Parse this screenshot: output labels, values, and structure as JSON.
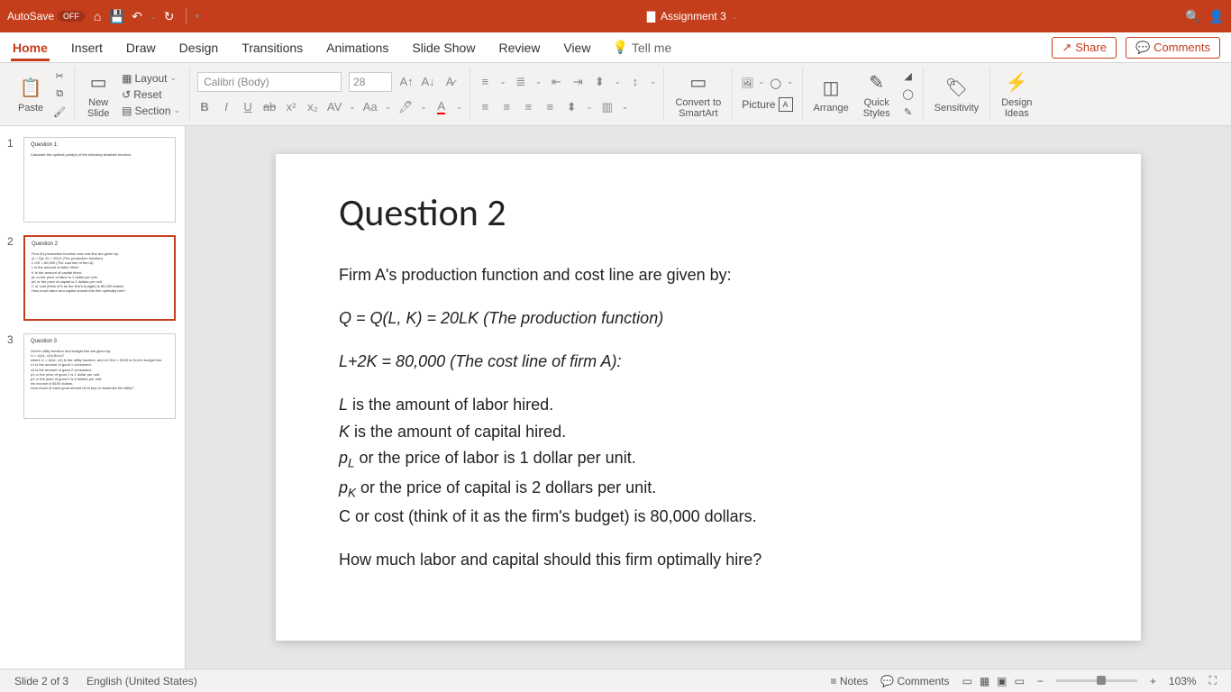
{
  "titlebar": {
    "autosave_label": "AutoSave",
    "autosave_state": "OFF",
    "doc_title": "Assignment 3"
  },
  "ribbon": {
    "tabs": [
      "Home",
      "Insert",
      "Draw",
      "Design",
      "Transitions",
      "Animations",
      "Slide Show",
      "Review",
      "View"
    ],
    "tellme": "Tell me",
    "share": "Share",
    "comments": "Comments"
  },
  "toolbar": {
    "paste": "Paste",
    "new_slide": "New\nSlide",
    "layout": "Layout",
    "reset": "Reset",
    "section": "Section",
    "font_name": "Calibri (Body)",
    "font_size": "28",
    "convert": "Convert to\nSmartArt",
    "picture": "Picture",
    "arrange": "Arrange",
    "quick_styles": "Quick\nStyles",
    "sensitivity": "Sensitivity",
    "design_ideas": "Design\nIdeas"
  },
  "thumbs": {
    "slide1": {
      "num": "1",
      "title": "Question 1:",
      "body": "Calculate the optimal point(s) of the following bivariate function:"
    },
    "slide2": {
      "num": "2",
      "title": "Question 2",
      "body1": "Firm A's production function and cost line are given by:",
      "body2": "Q = Q(L,K) = 20LK (The production function)",
      "body3": "L+2K = 80,000 (The cost line of firm A)",
      "body4": "L is the amount of labor hired.",
      "body5": "K is the amount of capital hired.",
      "body6": "pL or the price of labor is 1 dollar per unit.",
      "body7": "pK or the price of capital is 2 dollars per unit.",
      "body8": "C or cost (think of it as the firm's budget) is 80,000 dollars.",
      "body9": "How much labor and capital should this firm optimally hire?"
    },
    "slide3": {
      "num": "3",
      "title": "Question 3",
      "body1": "Omri's utility function and budget line are given by:",
      "body2": "U = U(x1, x2)=5x1x2",
      "body3": "where U = U(x1, x2) is the utility function, and x1+5x2 = $100 is Omri's budget line.",
      "body4": "x1 is the amount of good 1 consumed.",
      "body5": "x2 is the amount of good 2 consumed.",
      "body6": "p1 or the price of good 1 is 1 dollar per unit.",
      "body7": "p2 or the price of good 2 is 5 dollars per unit.",
      "body8": "his income is $100 dollars.",
      "body9": "How much of each good should Omri buy to maximize his utility?"
    }
  },
  "slide": {
    "title": "Question 2",
    "p1": "Firm A's production function and cost line are given by:",
    "p2_a": "Q = Q(L, K) = 20LK (",
    "p2_b": "The production function",
    "p2_c": ")",
    "p3": "L+2K  =  80,000 (The cost line of firm A):",
    "p4a": "L",
    "p4b": " is the amount of labor hired.",
    "p5a": "K",
    "p5b": " is the amount of capital hired.",
    "p6a": "p",
    "p6sub": "L",
    "p6b": " or the price of labor is 1 dollar per unit.",
    "p7a": "p",
    "p7sub": "K",
    "p7b": " or the price of capital is 2 dollars per unit.",
    "p8": "C or cost  (think of it as the firm's budget) is 80,000 dollars.",
    "p9": "How much labor and capital should this firm optimally hire?"
  },
  "statusbar": {
    "slide_of": "Slide 2 of 3",
    "language": "English (United States)",
    "notes": "Notes",
    "comments": "Comments",
    "zoom": "103%"
  }
}
